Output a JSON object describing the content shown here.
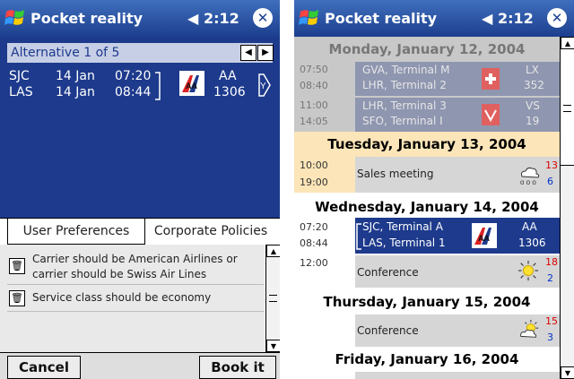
{
  "left_screen": {
    "title": "Pocket reality",
    "clock": "2:12",
    "alternative_label": "Alternative 1 of 5",
    "leg": {
      "from_code": "SJC",
      "from_date": "14 Jan",
      "from_time": "07:20",
      "to_code": "LAS",
      "to_date": "14 Jan",
      "to_time": "08:44",
      "airline": "AA",
      "flight": "1306"
    },
    "tabs": [
      {
        "label": "User Preferences"
      },
      {
        "label": "Corporate Policies"
      }
    ],
    "preferences": [
      {
        "line1": "Carrier should be American Airlines or",
        "line2": "carrier should be Swiss Air Lines"
      },
      {
        "line1": "Service class should be economy",
        "line2": ""
      }
    ],
    "buttons": {
      "cancel": "Cancel",
      "book": "Book it"
    }
  },
  "right_screen": {
    "title": "Pocket reality",
    "clock": "2:12",
    "days": [
      {
        "header": "Monday, January 12, 2004",
        "legs": [
          {
            "t1": "07:50",
            "t2": "08:40",
            "from": "GVA, Terminal M",
            "to": "LHR, Terminal 2",
            "carrier": "LX",
            "flight": "352"
          },
          {
            "t1": "11:00",
            "t2": "14:05",
            "from": "LHR, Terminal 3",
            "to": "SFO, Terminal I",
            "carrier": "VS",
            "flight": "19"
          }
        ]
      },
      {
        "header": "Tuesday, January 13, 2004",
        "event": {
          "t1": "10:00",
          "t2": "19:00",
          "title": "Sales meeting",
          "hi": "13",
          "lo": "6"
        }
      },
      {
        "header": "Wednesday, January 14, 2004",
        "flight": {
          "t1": "07:20",
          "t2": "08:44",
          "from": "SJC, Terminal A",
          "to": "LAS, Terminal 1",
          "carrier": "AA",
          "flight": "1306"
        },
        "event": {
          "t1": "12:00",
          "title": "Conference",
          "hi": "18",
          "lo": "2"
        }
      },
      {
        "header": "Thursday, January 15, 2004",
        "event": {
          "title": "Conference",
          "hi": "15",
          "lo": "3"
        }
      },
      {
        "header": "Friday, January 16, 2004"
      }
    ]
  },
  "icons": {
    "start": "windows-flag-icon",
    "volume": "speaker-icon",
    "close": "close-icon",
    "delete": "trash-icon",
    "airline": "american-airlines-logo-icon",
    "cloud": "cloud-rain-icon",
    "sun": "sun-icon",
    "partly": "partly-cloudy-icon"
  },
  "colors": {
    "titlebar": "#1c3f8e",
    "selection": "#1d3a8c",
    "highlight": "#fce5b8",
    "temp_hi": "#dd0000",
    "temp_lo": "#0033cc"
  }
}
